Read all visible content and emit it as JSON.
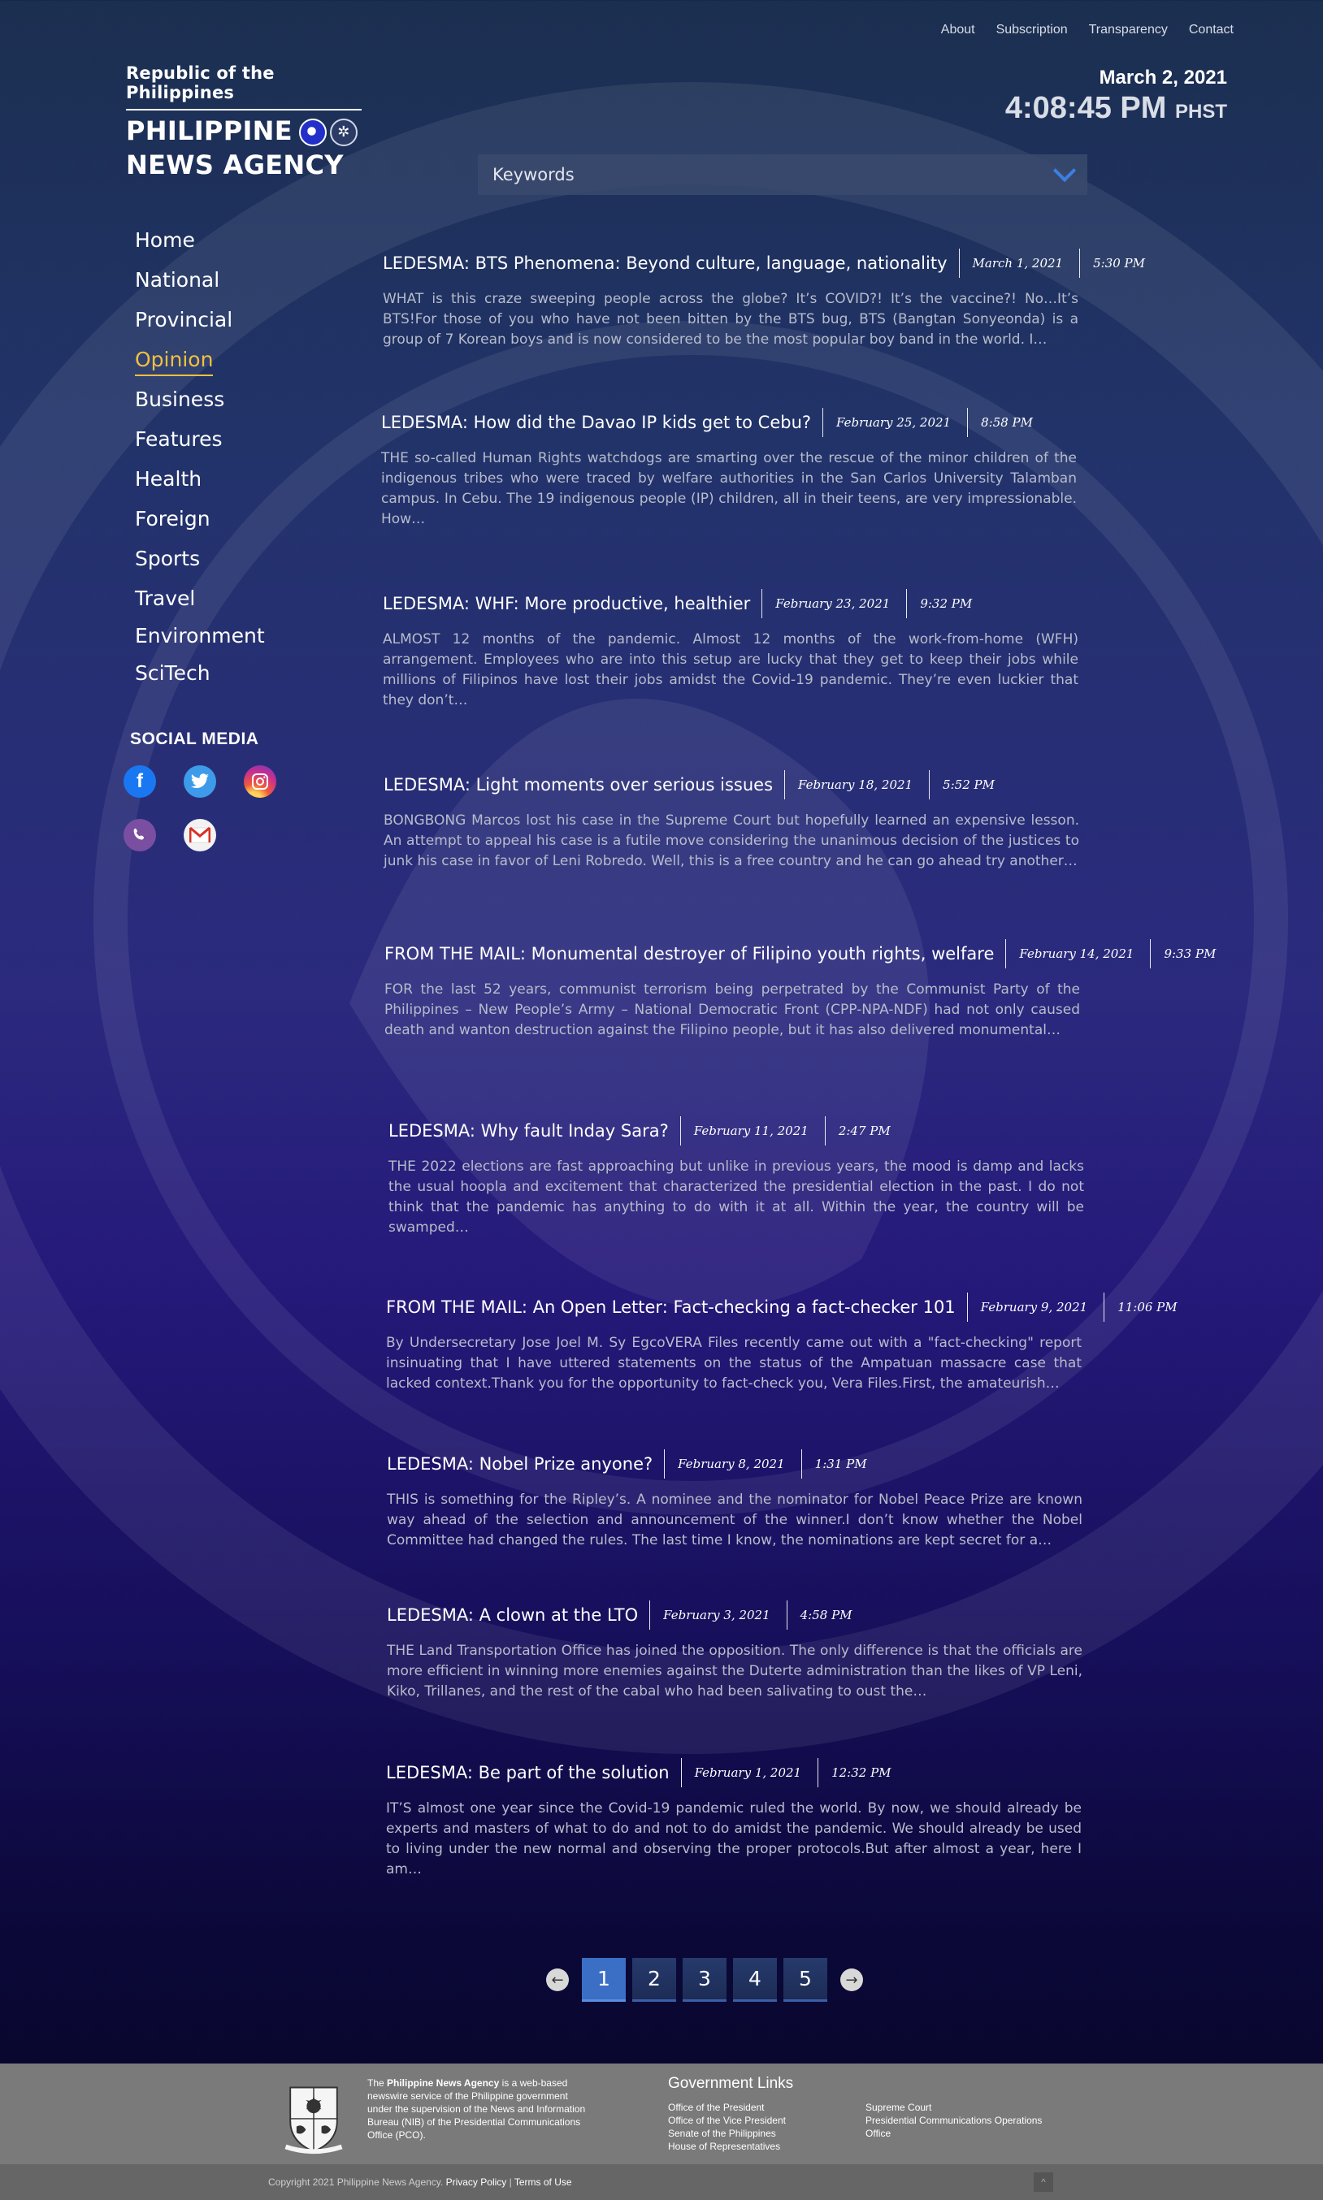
{
  "topnav": [
    "About",
    "Subscription",
    "Transparency",
    "Contact"
  ],
  "logo": {
    "republic": "Republic of the Philippines",
    "line1": "PHILIPPINE",
    "line2": "NEWS AGENCY"
  },
  "datetime": {
    "date": "March 2, 2021",
    "time": "4:08:45 PM",
    "tz": "PHST"
  },
  "search": {
    "placeholder": "Keywords"
  },
  "sidebar": {
    "items": [
      "Home",
      "National",
      "Provincial",
      "Opinion",
      "Business",
      "Features",
      "Health",
      "Foreign",
      "Sports",
      "Travel",
      "Environment",
      "SciTech"
    ],
    "active": "Opinion"
  },
  "social": {
    "title": "SOCIAL MEDIA",
    "icons": [
      "facebook-icon",
      "twitter-icon",
      "instagram-icon",
      "viber-icon",
      "gmail-icon"
    ]
  },
  "articles": [
    {
      "title": "LEDESMA: BTS Phenomena: Beyond culture, language, nationality",
      "date": "March 1, 2021",
      "time": "5:30 PM",
      "excerpt": "WHAT is this craze sweeping people across the globe? It’s COVID?! It’s the vaccine?! No…It’s BTS!For those of you who have not been bitten by the BTS bug, BTS (Bangtan Sonyeonda) is a group of 7 Korean boys and is now considered to be the most popular boy band in the world. I…"
    },
    {
      "title": "LEDESMA:  How did the Davao IP kids get to Cebu?",
      "date": "February 25, 2021",
      "time": "8:58 PM",
      "excerpt": "THE so-called Human Rights watchdogs are smarting over the rescue of the minor children of the indigenous tribes who were traced by welfare authorities in the San Carlos University Talamban campus. In Cebu. The 19 indigenous people (IP) children, all in their teens, are very impressionable. How…"
    },
    {
      "title": "LEDESMA: WHF: More productive, healthier",
      "date": "February 23, 2021",
      "time": "9:32 PM",
      "excerpt": "ALMOST 12 months of the pandemic. Almost 12 months of the work-from-home (WFH) arrangement. Employees who are into this setup are lucky that they get to keep their jobs while millions of Filipinos have lost their jobs amidst the Covid-19 pandemic. They’re even luckier that they don’t…"
    },
    {
      "title": "LEDESMA: Light moments over serious issues",
      "date": "February 18, 2021",
      "time": "5:52 PM",
      "excerpt": "BONGBONG Marcos lost his case in the Supreme Court but hopefully learned an expensive lesson. An attempt to appeal his case is a futile move considering the unanimous decision of the justices to junk his case in favor of Leni Robredo. Well, this is a free country and he can go ahead try another…"
    },
    {
      "title": "FROM THE MAIL: Monumental destroyer of Filipino youth rights, welfare",
      "date": "February 14, 2021",
      "time": "9:33 PM",
      "excerpt": "FOR the last 52 years, communist terrorism being perpetrated by the Communist Party of the Philippines – New People’s Army – National Democratic Front (CPP-NPA-NDF) had not only caused death and wanton destruction against the Filipino people, but it has also delivered monumental…"
    },
    {
      "title": "LEDESMA: Why fault Inday Sara?",
      "date": "February 11, 2021",
      "time": "2:47 PM",
      "excerpt": "THE 2022 elections are fast approaching but unlike in previous years, the mood is damp and lacks the usual hoopla and excitement that characterized the presidential election in the past. I do not think that the pandemic has anything to do with it at all. Within the year, the country will be swamped…"
    },
    {
      "title": "FROM THE MAIL: An Open Letter: Fact-checking a fact-checker 101",
      "date": "February 9, 2021",
      "time": "11:06 PM",
      "excerpt": "By Undersecretary Jose Joel M. Sy EgcoVERA Files recently came out with a \"fact-checking\" report insinuating that I have uttered statements on the status of the Ampatuan massacre case that lacked context.Thank you for the opportunity to fact-check you, Vera Files.First, the amateurish…"
    },
    {
      "title": "LEDESMA: Nobel Prize anyone?",
      "date": "February 8, 2021",
      "time": "1:31 PM",
      "excerpt": "THIS is something for the Ripley’s. A nominee and the nominator for Nobel Peace Prize are known way ahead of the selection and announcement of the winner.I don’t know whether the Nobel Committee had changed the rules. The last time I know, the nominations are kept secret for a…"
    },
    {
      "title": "LEDESMA: A clown at the LTO",
      "date": "February 3, 2021",
      "time": "4:58 PM",
      "excerpt": "THE Land Transportation Office has joined the opposition. The only difference is that the officials are more efficient in winning more enemies against the Duterte administration than the likes of VP Leni, Kiko, Trillanes, and the rest of the cabal who had been salivating to oust the…"
    },
    {
      "title": "LEDESMA: Be part of the solution",
      "date": "February 1, 2021",
      "time": "12:32 PM",
      "excerpt": "IT’S almost one year since the Covid-19 pandemic ruled the world. By now, we should already be experts and masters of what to do and not to do amidst the pandemic. We should already be used to living under the new normal and observing the proper protocols.But after almost a year, here I am…"
    }
  ],
  "pagination": {
    "pages": [
      "1",
      "2",
      "3",
      "4",
      "5"
    ],
    "current": "1",
    "prev": "←",
    "next": "→"
  },
  "footer": {
    "about_pre": "The ",
    "about_name": "Philippine News Agency",
    "about_post": " is a web-based newswire service of the Philippine government under the supervision of the News and Information Bureau (NIB) of the Presidential Communications Office (PCO).",
    "gov_title": "Government Links",
    "links_left": [
      "Office of the President",
      "Office of the Vice President",
      "Senate of the Philippines",
      "House of Representatives"
    ],
    "links_right": [
      "Supreme Court",
      "Presidential Communications Operations Office"
    ],
    "copyright": "Copyright 2021 Philippine News Agency.",
    "privacy": "Privacy Policy",
    "separator": "|",
    "terms": "Terms of Use",
    "top_arrow": "^"
  },
  "colors": {
    "accent": "#f0c040",
    "link_blue": "#3c7fe0",
    "page_active": "#3b6fc6",
    "footer": "#7a7a7a"
  }
}
